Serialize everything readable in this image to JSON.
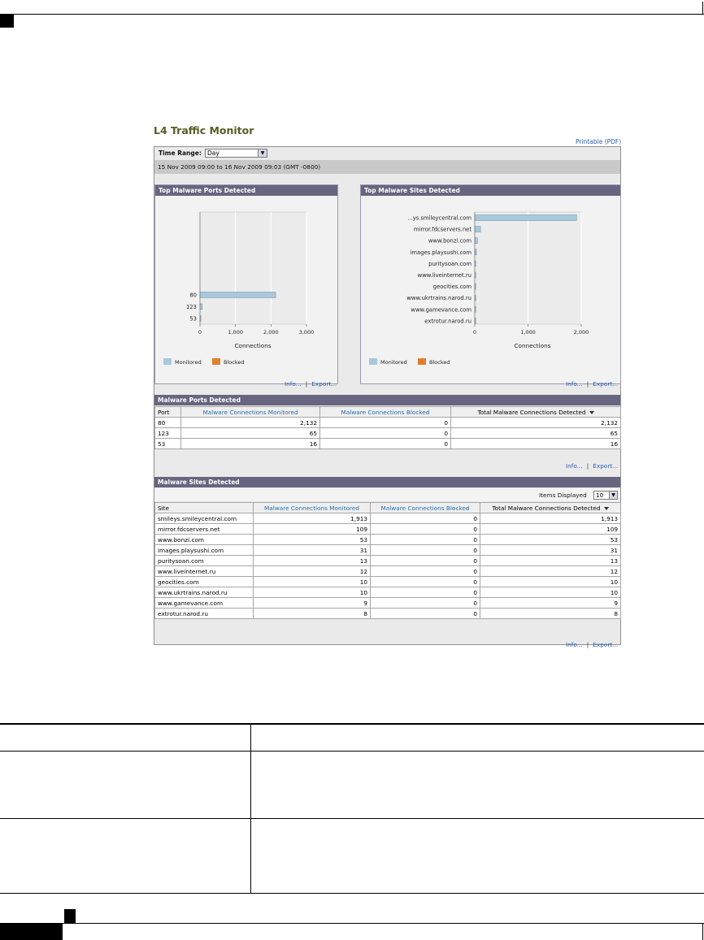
{
  "page": {
    "title": "L4 Traffic Monitor",
    "printable_link": "Printable (PDF)",
    "time_range_label": "Time Range:",
    "time_range_value": "Day",
    "date_range": "15 Nov 2009 09:00 to 16 Nov 2009 09:03 (GMT -0800)"
  },
  "ports_chart_panel": {
    "header": "Top Malware Ports Detected",
    "legend": [
      "Monitored",
      "Blocked"
    ],
    "info_link": "Info...",
    "export_link": "Export...",
    "separator": "|"
  },
  "sites_chart_panel": {
    "header": "Top Malware Sites Detected",
    "legend": [
      "Monitored",
      "Blocked"
    ],
    "info_link": "Info...",
    "export_link": "Export...",
    "separator": "|"
  },
  "colors": {
    "monitored": "#a9c8dc",
    "blocked": "#e37e2b",
    "header_bg": "#67657f"
  },
  "ports_table": {
    "header": "Malware Ports Detected",
    "columns": [
      "Port",
      "Malware Connections Monitored",
      "Malware Connections Blocked",
      "Total Malware Connections Detected"
    ],
    "rows": [
      [
        "80",
        "2,132",
        "0",
        "2,132"
      ],
      [
        "123",
        "65",
        "0",
        "65"
      ],
      [
        "53",
        "16",
        "0",
        "16"
      ]
    ],
    "info_link": "Info...",
    "export_link": "Export...",
    "separator": "|"
  },
  "sites_table": {
    "header": "Malware Sites Detected",
    "items_label": "Items Displayed",
    "items_value": "10",
    "columns": [
      "Site",
      "Malware Connections Monitored",
      "Malware Connections Blocked",
      "Total Malware Connections Detected"
    ],
    "rows": [
      [
        "smileys.smileycentral.com",
        "1,913",
        "0",
        "1,913"
      ],
      [
        "mirror.fdcservers.net",
        "109",
        "0",
        "109"
      ],
      [
        "www.bonzi.com",
        "53",
        "0",
        "53"
      ],
      [
        "images.playsushi.com",
        "31",
        "0",
        "31"
      ],
      [
        "puritysoan.com",
        "13",
        "0",
        "13"
      ],
      [
        "www.liveinternet.ru",
        "12",
        "0",
        "12"
      ],
      [
        "geocities.com",
        "10",
        "0",
        "10"
      ],
      [
        "www.ukrtrains.narod.ru",
        "10",
        "0",
        "10"
      ],
      [
        "www.gamevance.com",
        "9",
        "0",
        "9"
      ],
      [
        "extrotur.narod.ru",
        "8",
        "0",
        "8"
      ]
    ],
    "info_link": "Info...",
    "export_link": "Export...",
    "separator": "|"
  },
  "chart_data": [
    {
      "type": "bar",
      "orientation": "horizontal",
      "title": "Top Malware Ports Detected",
      "xlabel": "Connections",
      "ylabel": "",
      "categories": [
        "80",
        "123",
        "53"
      ],
      "series": [
        {
          "name": "Monitored",
          "values": [
            2132,
            65,
            16
          ]
        },
        {
          "name": "Blocked",
          "values": [
            0,
            0,
            0
          ]
        }
      ],
      "xlim": [
        0,
        3000
      ],
      "xticks": [
        "0",
        "1,000",
        "2,000",
        "3,000"
      ],
      "grid": true,
      "legend": "bottom-left"
    },
    {
      "type": "bar",
      "orientation": "horizontal",
      "title": "Top Malware Sites Detected",
      "xlabel": "Connections",
      "ylabel": "",
      "categories": [
        "...ys.smileycentral.com",
        "mirror.fdcservers.net",
        "www.bonzi.com",
        "images.playsushi.com",
        "puritysoan.com",
        "www.liveinternet.ru",
        "geocities.com",
        "www.ukrtrains.narod.ru",
        "www.gamevance.com",
        "extrotur.narod.ru"
      ],
      "series": [
        {
          "name": "Monitored",
          "values": [
            1913,
            109,
            53,
            31,
            13,
            12,
            10,
            10,
            9,
            8
          ]
        },
        {
          "name": "Blocked",
          "values": [
            0,
            0,
            0,
            0,
            0,
            0,
            0,
            0,
            0,
            0
          ]
        }
      ],
      "xlim": [
        0,
        2000
      ],
      "xticks": [
        "0",
        "1,000",
        "2,000"
      ],
      "grid": true,
      "legend": "bottom-left"
    }
  ]
}
